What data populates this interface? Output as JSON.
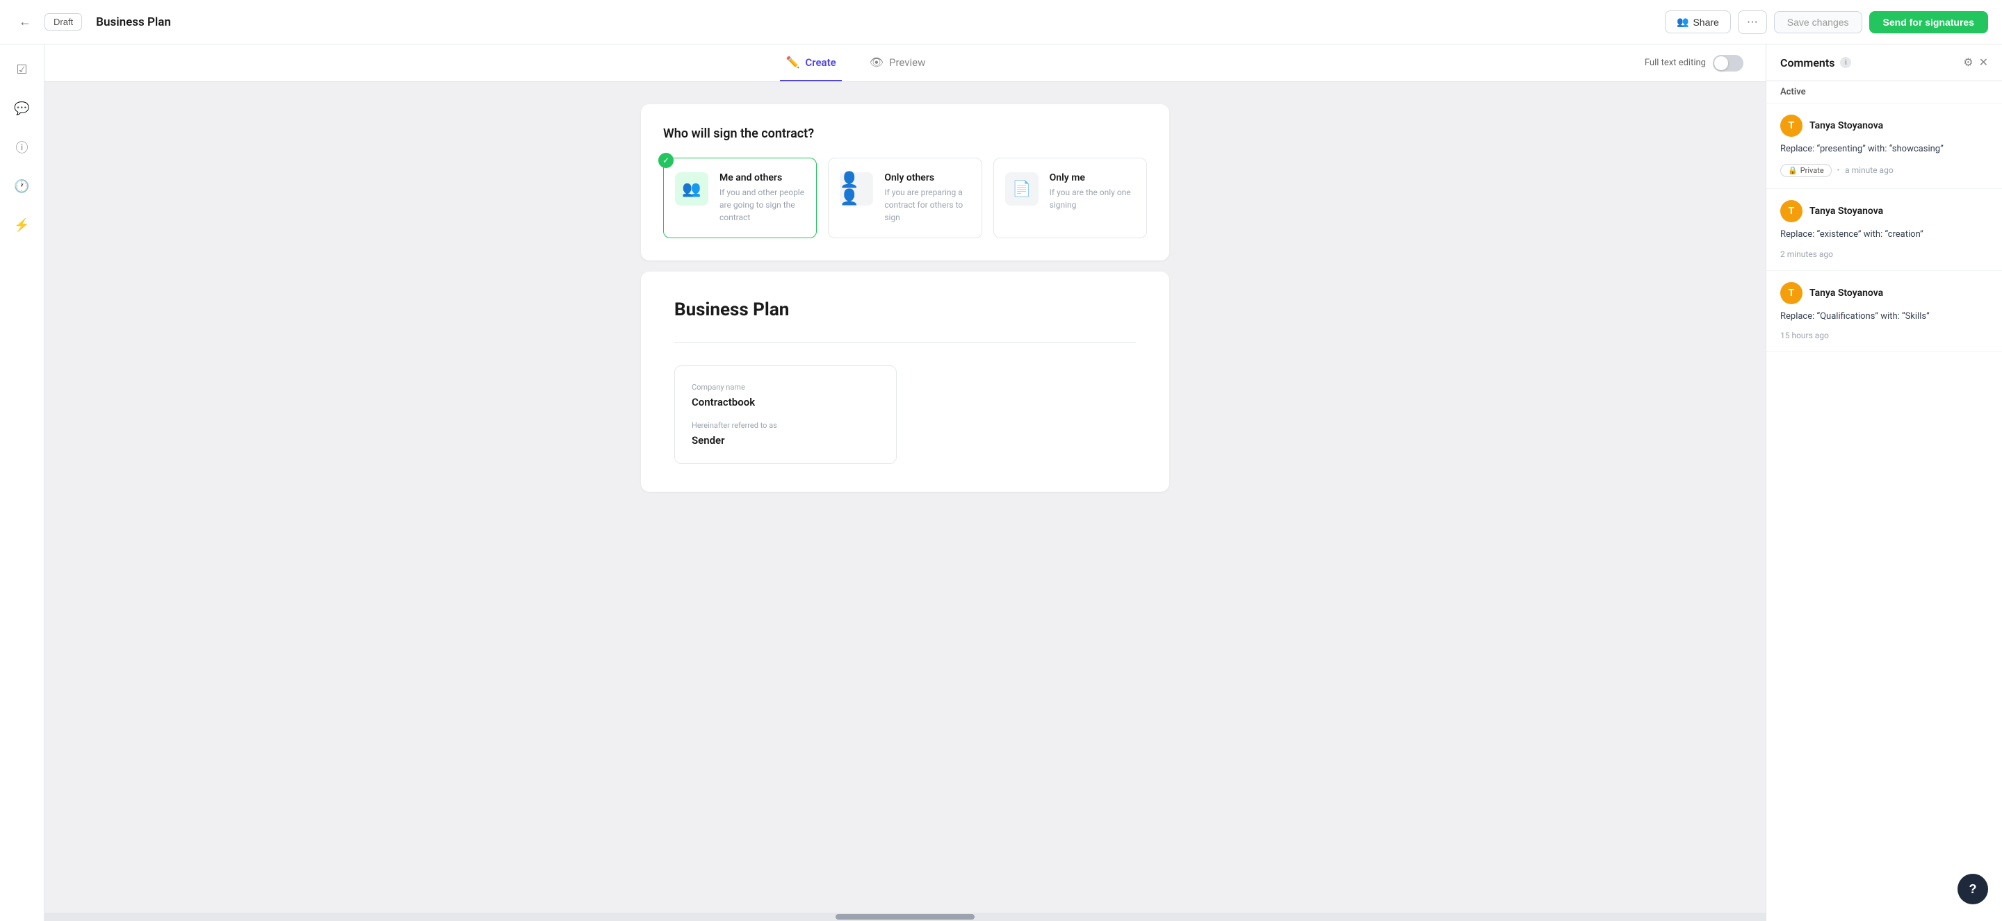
{
  "header": {
    "back_label": "←",
    "draft_label": "Draft",
    "doc_title": "Business Plan",
    "share_label": "Share",
    "more_label": "···",
    "save_label": "Save changes",
    "send_label": "Send for signatures"
  },
  "tabs": {
    "create_label": "Create",
    "preview_label": "Preview",
    "full_text_label": "Full text editing"
  },
  "signer_section": {
    "title": "Who will sign the contract?",
    "options": [
      {
        "id": "me-and-others",
        "label": "Me and others",
        "description": "If you and other people are going to sign the contract",
        "selected": true
      },
      {
        "id": "only-others",
        "label": "Only others",
        "description": "If you are preparing a contract for others to sign",
        "selected": false
      },
      {
        "id": "only-me",
        "label": "Only me",
        "description": "If you are the only one signing",
        "selected": false
      }
    ]
  },
  "document": {
    "title": "Business Plan",
    "form": {
      "company_name_label": "Company name",
      "company_name_value": "Contractbook",
      "referred_as_label": "Hereinafter referred to as",
      "referred_as_value": "Sender"
    }
  },
  "comments_panel": {
    "title": "Comments",
    "active_label": "Active",
    "comments": [
      {
        "author": "Tanya Stoyanova",
        "avatar_letter": "T",
        "text_prefix": "Replace: “presenting” with: “showcasing”",
        "private": true,
        "private_label": "Private",
        "time": "a minute ago"
      },
      {
        "author": "Tanya Stoyanova",
        "avatar_letter": "T",
        "text_prefix": "Replace: “existence” with: “creation”",
        "private": false,
        "time": "2 minutes ago"
      },
      {
        "author": "Tanya Stoyanova",
        "avatar_letter": "T",
        "text_prefix": "Replace: “Qualifications” with: “Skills”",
        "private": false,
        "time": "15 hours ago"
      }
    ]
  },
  "sidebar_icons": [
    {
      "id": "check-icon",
      "symbol": "☑"
    },
    {
      "id": "chat-icon",
      "symbol": "💬"
    },
    {
      "id": "info-icon",
      "symbol": "ⓘ"
    },
    {
      "id": "history-icon",
      "symbol": "🕐"
    },
    {
      "id": "bolt-icon",
      "symbol": "⚡"
    }
  ]
}
